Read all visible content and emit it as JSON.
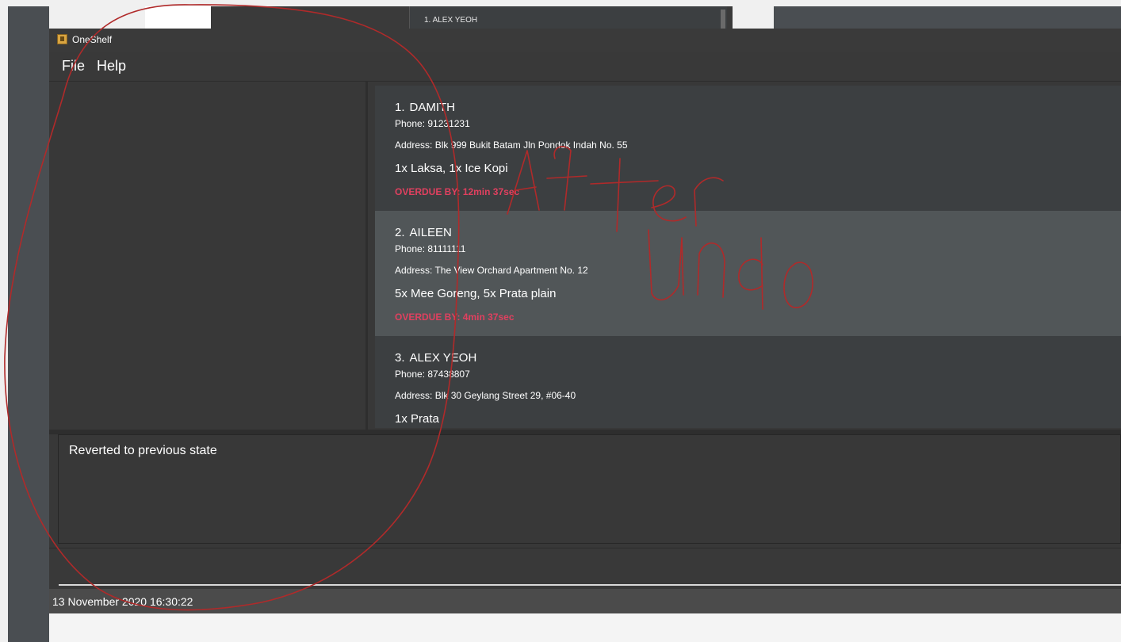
{
  "background": {
    "list_item_text": "1.  ALEX YEOH"
  },
  "window": {
    "title": "OneShelf",
    "menu": [
      "File",
      "Help"
    ]
  },
  "orders": [
    {
      "index": "1.",
      "name": "DAMITH",
      "phone": "Phone: 91231231",
      "address": "Address: Blk 999 Bukit Batam Jln Pondok Indah No. 55",
      "items": "1x Laksa, 1x Ice Kopi",
      "overdue": "OVERDUE BY: 12min 37sec"
    },
    {
      "index": "2.",
      "name": "AILEEN",
      "phone": "Phone: 81111111",
      "address": "Address: The View Orchard Apartment No. 12",
      "items": "5x Mee Goreng, 5x Prata plain",
      "overdue": "OVERDUE BY: 4min 37sec"
    },
    {
      "index": "3.",
      "name": "ALEX YEOH",
      "phone": "Phone: 87438807",
      "address": "Address: Blk 30 Geylang Street 29, #06-40",
      "items": "1x Prata"
    }
  ],
  "result_display": {
    "text": "Reverted to previous state"
  },
  "command_box": {
    "value": ""
  },
  "status_bar": {
    "datetime": "13 November 2020 16:30:22"
  },
  "annotation": {
    "handwritten_text": "After Undo",
    "color": "#b02a2a"
  },
  "colors": {
    "overdue": "#e0405f",
    "selected_card": "#515658",
    "card": "#3c3f41",
    "window_bg": "#383838"
  }
}
